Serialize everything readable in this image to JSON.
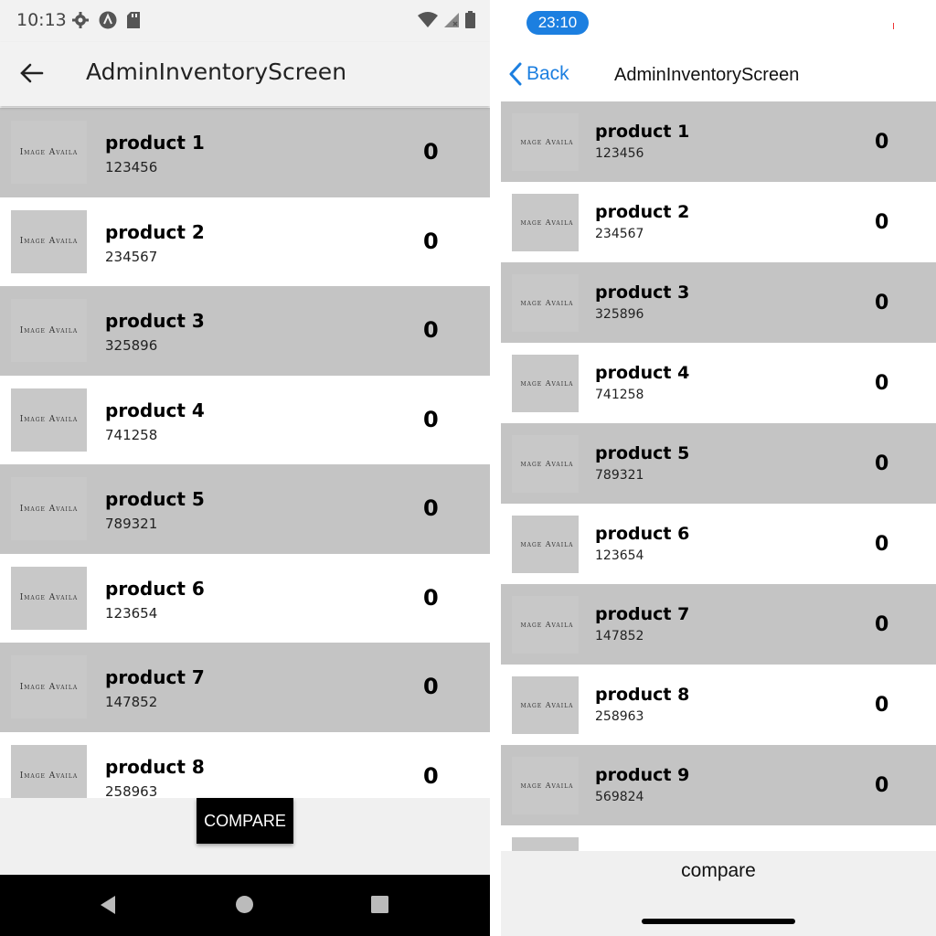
{
  "android": {
    "status_time": "10:13",
    "title": "AdminInventoryScreen",
    "compare_label": "COMPARE",
    "products": [
      {
        "name": "product 1",
        "code": "123456",
        "qty": "0",
        "thumb": "Image Availa"
      },
      {
        "name": "product 2",
        "code": "234567",
        "qty": "0",
        "thumb": "Image Availa"
      },
      {
        "name": "product 3",
        "code": "325896",
        "qty": "0",
        "thumb": "Image Availa"
      },
      {
        "name": "product 4",
        "code": "741258",
        "qty": "0",
        "thumb": "Image Availa"
      },
      {
        "name": "product 5",
        "code": "789321",
        "qty": "0",
        "thumb": "Image Availa"
      },
      {
        "name": "product 6",
        "code": "123654",
        "qty": "0",
        "thumb": "Image Availa"
      },
      {
        "name": "product 7",
        "code": "147852",
        "qty": "0",
        "thumb": "Image Availa"
      },
      {
        "name": "product 8",
        "code": "258963",
        "qty": "0",
        "thumb": "Image Availa"
      }
    ]
  },
  "ios": {
    "status_time": "23:10",
    "back_label": "Back",
    "title": "AdminInventoryScreen",
    "compare_label": "compare",
    "accent_color": "#1c7fe0",
    "products": [
      {
        "name": "product 1",
        "code": "123456",
        "qty": "0",
        "thumb": "mage Availa"
      },
      {
        "name": "product 2",
        "code": "234567",
        "qty": "0",
        "thumb": "mage Availa"
      },
      {
        "name": "product 3",
        "code": "325896",
        "qty": "0",
        "thumb": "mage Availa"
      },
      {
        "name": "product 4",
        "code": "741258",
        "qty": "0",
        "thumb": "mage Availa"
      },
      {
        "name": "product 5",
        "code": "789321",
        "qty": "0",
        "thumb": "mage Availa"
      },
      {
        "name": "product 6",
        "code": "123654",
        "qty": "0",
        "thumb": "mage Availa"
      },
      {
        "name": "product 7",
        "code": "147852",
        "qty": "0",
        "thumb": "mage Availa"
      },
      {
        "name": "product 8",
        "code": "258963",
        "qty": "0",
        "thumb": "mage Availa"
      },
      {
        "name": "product 9",
        "code": "569824",
        "qty": "0",
        "thumb": "mage Availa"
      },
      {
        "name": "",
        "code": "",
        "qty": "",
        "thumb": ""
      }
    ]
  },
  "colors": {
    "row_gray": "#c4c4c4",
    "android_button": "#000000"
  }
}
